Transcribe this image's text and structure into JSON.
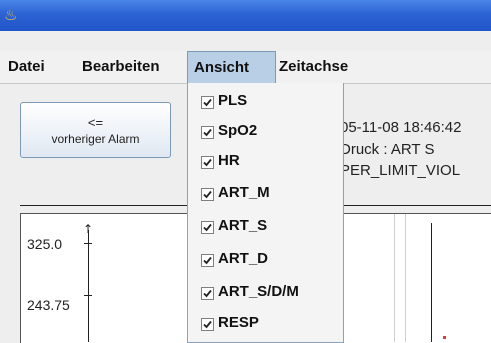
{
  "titlebar": {
    "icon": "java-coffee-icon"
  },
  "menubar": {
    "items": [
      {
        "label": "Datei"
      },
      {
        "label": "Bearbeiten"
      },
      {
        "label": "Ansicht"
      },
      {
        "label": "Zeitachse"
      }
    ],
    "active_index": 2
  },
  "toolbar": {
    "prev_alarm": {
      "arrow": "<=",
      "label": "vorheriger Alarm"
    }
  },
  "alarm_info": {
    "line1": "05-11-08 18:46:42",
    "line2": "Druck : ART S",
    "line3": "PER_LIMIT_VIOL"
  },
  "plot": {
    "y_ticks": [
      "325.0",
      "243.75"
    ]
  },
  "ansicht_menu": {
    "items": [
      {
        "label": "PLS",
        "checked": true
      },
      {
        "label": "SpO2",
        "checked": true
      },
      {
        "label": "HR",
        "checked": true
      },
      {
        "label": "ART_M",
        "checked": true
      },
      {
        "label": "ART_S",
        "checked": true
      },
      {
        "label": "ART_D",
        "checked": true
      },
      {
        "label": "ART_S/D/M",
        "checked": true
      },
      {
        "label": "RESP",
        "checked": true
      }
    ]
  },
  "colors": {
    "titlebar": "#2c62d4",
    "menu_highlight": "#b8cfe5",
    "signal_red": "#e03a3a"
  }
}
